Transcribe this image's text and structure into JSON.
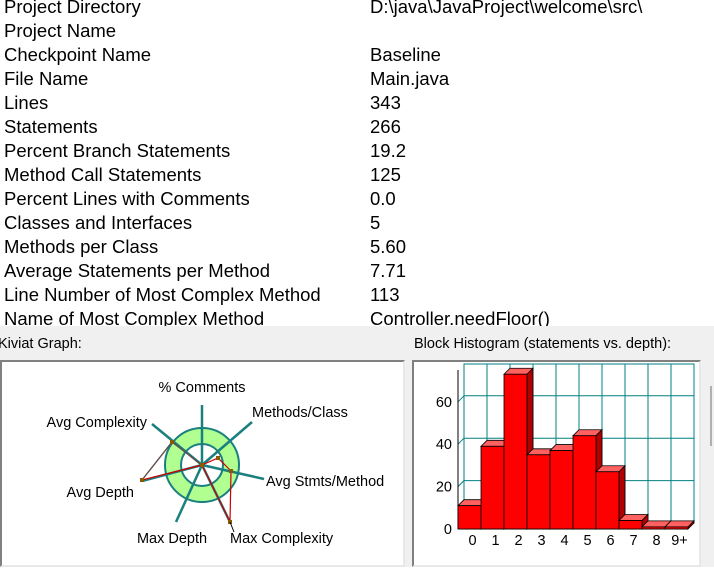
{
  "metrics": [
    {
      "label": "Project Directory",
      "value": "D:\\java\\JavaProject\\welcome\\src\\"
    },
    {
      "label": "Project Name",
      "value": ""
    },
    {
      "label": "Checkpoint Name",
      "value": "Baseline"
    },
    {
      "label": "File Name",
      "value": "Main.java"
    },
    {
      "label": "Lines",
      "value": "343"
    },
    {
      "label": "Statements",
      "value": "266"
    },
    {
      "label": "Percent Branch Statements",
      "value": "19.2"
    },
    {
      "label": "Method Call Statements",
      "value": "125"
    },
    {
      "label": "Percent Lines with Comments",
      "value": "0.0"
    },
    {
      "label": "Classes and Interfaces",
      "value": "5"
    },
    {
      "label": "Methods per Class",
      "value": "5.60"
    },
    {
      "label": "Average Statements per Method",
      "value": "7.71"
    },
    {
      "label": "Line Number of Most Complex Method",
      "value": "113"
    },
    {
      "label": "Name of Most Complex Method",
      "value": "Controller.needFloor()"
    }
  ],
  "kiviat": {
    "title": "Kiviat Graph:",
    "axes": [
      "% Comments",
      "Methods/Class",
      "Avg Stmts/Method",
      "Max Complexity",
      "Max Depth",
      "Avg Depth",
      "Avg Complexity"
    ],
    "colors": {
      "ring": "#b0ff90",
      "axis": "#1a7f7f",
      "plot": "#cc0000",
      "point": "#8a5a00"
    }
  },
  "histogram": {
    "title": "Block Histogram (statements vs. depth):",
    "bar_color": "#ff0000",
    "grid_color": "#008080",
    "chart_data": {
      "type": "bar",
      "categories": [
        "0",
        "1",
        "2",
        "3",
        "4",
        "5",
        "6",
        "7",
        "8",
        "9+"
      ],
      "values": [
        11,
        39,
        73,
        35,
        37,
        44,
        27,
        4,
        1,
        1
      ],
      "y_ticks": [
        "0",
        "20",
        "40",
        "60"
      ],
      "ylim": [
        0,
        75
      ],
      "grid": true
    }
  }
}
